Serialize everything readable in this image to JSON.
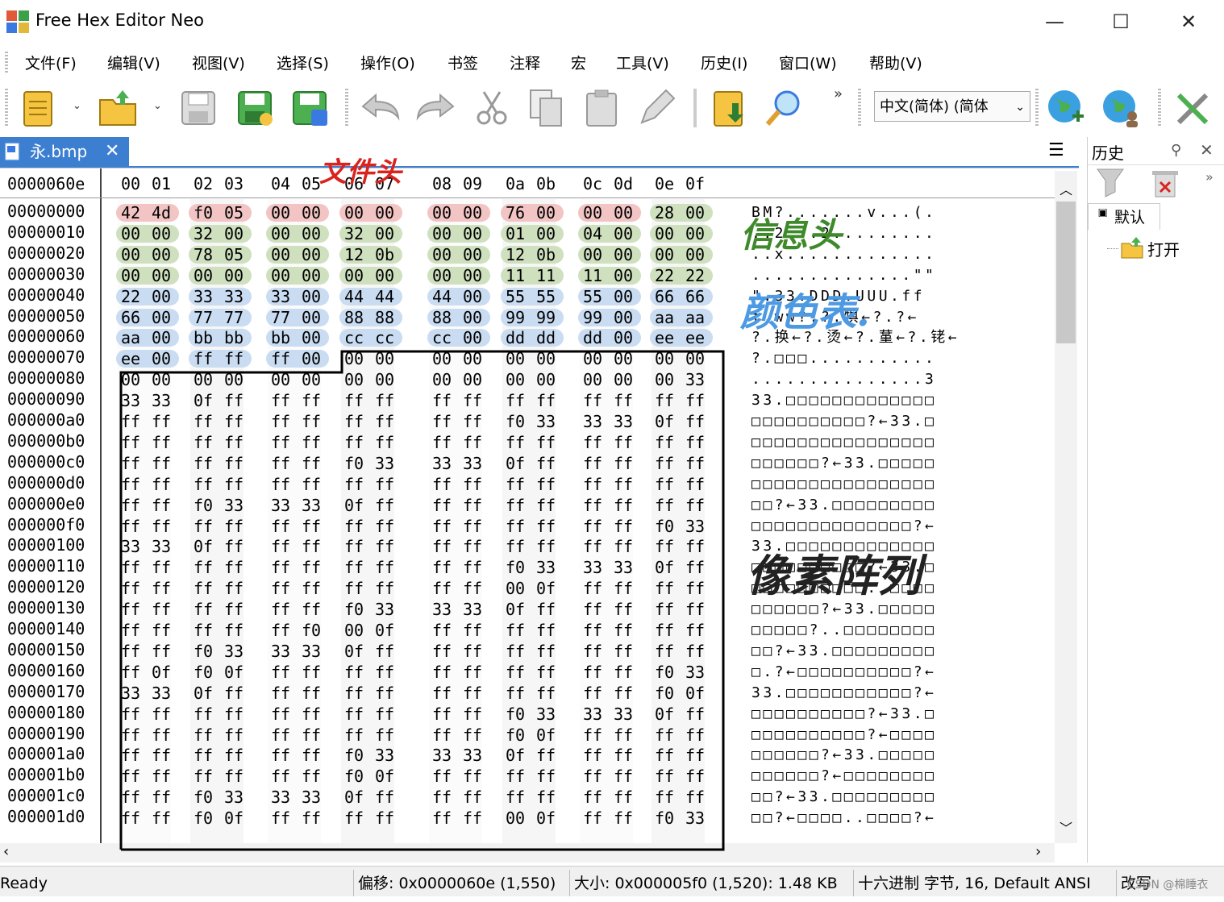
{
  "window": {
    "title": "Free Hex Editor Neo",
    "minimize": "—",
    "maximize": "☐",
    "close": "✕"
  },
  "menu": [
    "文件(F)",
    "编辑(V)",
    "视图(V)",
    "选择(S)",
    "操作(O)",
    "书签",
    "注释",
    "宏",
    "工具(V)",
    "历史(I)",
    "窗口(W)",
    "帮助(V)"
  ],
  "toolbar": {
    "language": "中文(简体) (简体",
    "overflow": "»"
  },
  "tab": {
    "name": "永.bmp",
    "close": "✕"
  },
  "hex": {
    "current_offset": "0000060e",
    "columns": [
      "00",
      "01",
      "02",
      "03",
      "04",
      "05",
      "06",
      "07",
      "08",
      "09",
      "0a",
      "0b",
      "0c",
      "0d",
      "0e",
      "0f"
    ],
    "rows": [
      {
        "offset": "00000000",
        "bytes": [
          "42",
          "4d",
          "f0",
          "05",
          "00",
          "00",
          "00",
          "00",
          "00",
          "00",
          "76",
          "00",
          "00",
          "00",
          "28",
          "00"
        ],
        "ascii": "BM?.......v...(."
      },
      {
        "offset": "00000010",
        "bytes": [
          "00",
          "00",
          "32",
          "00",
          "00",
          "00",
          "32",
          "00",
          "00",
          "00",
          "01",
          "00",
          "04",
          "00",
          "00",
          "00"
        ],
        "ascii": "..2...2........."
      },
      {
        "offset": "00000020",
        "bytes": [
          "00",
          "00",
          "78",
          "05",
          "00",
          "00",
          "12",
          "0b",
          "00",
          "00",
          "12",
          "0b",
          "00",
          "00",
          "00",
          "00"
        ],
        "ascii": "..x............."
      },
      {
        "offset": "00000030",
        "bytes": [
          "00",
          "00",
          "00",
          "00",
          "00",
          "00",
          "00",
          "00",
          "00",
          "00",
          "11",
          "11",
          "11",
          "00",
          "22",
          "22"
        ],
        "ascii": "..............\"\""
      },
      {
        "offset": "00000040",
        "bytes": [
          "22",
          "00",
          "33",
          "33",
          "33",
          "00",
          "44",
          "44",
          "44",
          "00",
          "55",
          "55",
          "55",
          "00",
          "66",
          "66"
        ],
        "ascii": "\".33.DDD.UUU.ff"
      },
      {
        "offset": "00000050",
        "bytes": [
          "66",
          "00",
          "77",
          "77",
          "77",
          "00",
          "88",
          "88",
          "88",
          "00",
          "99",
          "99",
          "99",
          "00",
          "aa",
          "aa"
        ],
        "ascii": "f.ww?.?.犋←?.?←"
      },
      {
        "offset": "00000060",
        "bytes": [
          "aa",
          "00",
          "bb",
          "bb",
          "bb",
          "00",
          "cc",
          "cc",
          "cc",
          "00",
          "dd",
          "dd",
          "dd",
          "00",
          "ee",
          "ee"
        ],
        "ascii": "?.换←?.烫←?.蓳←?.铑←"
      },
      {
        "offset": "00000070",
        "bytes": [
          "ee",
          "00",
          "ff",
          "ff",
          "ff",
          "00",
          "00",
          "00",
          "00",
          "00",
          "00",
          "00",
          "00",
          "00",
          "00",
          "00"
        ],
        "ascii": "?.□□□..........."
      },
      {
        "offset": "00000080",
        "bytes": [
          "00",
          "00",
          "00",
          "00",
          "00",
          "00",
          "00",
          "00",
          "00",
          "00",
          "00",
          "00",
          "00",
          "00",
          "00",
          "33"
        ],
        "ascii": "...............3"
      },
      {
        "offset": "00000090",
        "bytes": [
          "33",
          "33",
          "0f",
          "ff",
          "ff",
          "ff",
          "ff",
          "ff",
          "ff",
          "ff",
          "ff",
          "ff",
          "ff",
          "ff",
          "ff",
          "ff"
        ],
        "ascii": "33.□□□□□□□□□□□□□"
      },
      {
        "offset": "000000a0",
        "bytes": [
          "ff",
          "ff",
          "ff",
          "ff",
          "ff",
          "ff",
          "ff",
          "ff",
          "ff",
          "ff",
          "f0",
          "33",
          "33",
          "33",
          "0f",
          "ff"
        ],
        "ascii": "□□□□□□□□□□?←33.□"
      },
      {
        "offset": "000000b0",
        "bytes": [
          "ff",
          "ff",
          "ff",
          "ff",
          "ff",
          "ff",
          "ff",
          "ff",
          "ff",
          "ff",
          "ff",
          "ff",
          "ff",
          "ff",
          "ff",
          "ff"
        ],
        "ascii": "□□□□□□□□□□□□□□□□"
      },
      {
        "offset": "000000c0",
        "bytes": [
          "ff",
          "ff",
          "ff",
          "ff",
          "ff",
          "ff",
          "f0",
          "33",
          "33",
          "33",
          "0f",
          "ff",
          "ff",
          "ff",
          "ff",
          "ff"
        ],
        "ascii": "□□□□□□?←33.□□□□□"
      },
      {
        "offset": "000000d0",
        "bytes": [
          "ff",
          "ff",
          "ff",
          "ff",
          "ff",
          "ff",
          "ff",
          "ff",
          "ff",
          "ff",
          "ff",
          "ff",
          "ff",
          "ff",
          "ff",
          "ff"
        ],
        "ascii": "□□□□□□□□□□□□□□□□"
      },
      {
        "offset": "000000e0",
        "bytes": [
          "ff",
          "ff",
          "f0",
          "33",
          "33",
          "33",
          "0f",
          "ff",
          "ff",
          "ff",
          "ff",
          "ff",
          "ff",
          "ff",
          "ff",
          "ff"
        ],
        "ascii": "□□?←33.□□□□□□□□□"
      },
      {
        "offset": "000000f0",
        "bytes": [
          "ff",
          "ff",
          "ff",
          "ff",
          "ff",
          "ff",
          "ff",
          "ff",
          "ff",
          "ff",
          "ff",
          "ff",
          "ff",
          "ff",
          "f0",
          "33"
        ],
        "ascii": "□□□□□□□□□□□□□□?←"
      },
      {
        "offset": "00000100",
        "bytes": [
          "33",
          "33",
          "0f",
          "ff",
          "ff",
          "ff",
          "ff",
          "ff",
          "ff",
          "ff",
          "ff",
          "ff",
          "ff",
          "ff",
          "ff",
          "ff"
        ],
        "ascii": "33.□□□□□□□□□□□□□"
      },
      {
        "offset": "00000110",
        "bytes": [
          "ff",
          "ff",
          "ff",
          "ff",
          "ff",
          "ff",
          "ff",
          "ff",
          "ff",
          "ff",
          "f0",
          "33",
          "33",
          "33",
          "0f",
          "ff"
        ],
        "ascii": "□□□□□□□□□□?←33.□"
      },
      {
        "offset": "00000120",
        "bytes": [
          "ff",
          "ff",
          "ff",
          "ff",
          "ff",
          "ff",
          "ff",
          "ff",
          "ff",
          "ff",
          "00",
          "0f",
          "ff",
          "ff",
          "ff",
          "ff"
        ],
        "ascii": "□□□□□□□□□□..□□□□"
      },
      {
        "offset": "00000130",
        "bytes": [
          "ff",
          "ff",
          "ff",
          "ff",
          "ff",
          "ff",
          "f0",
          "33",
          "33",
          "33",
          "0f",
          "ff",
          "ff",
          "ff",
          "ff",
          "ff"
        ],
        "ascii": "□□□□□□?←33.□□□□□"
      },
      {
        "offset": "00000140",
        "bytes": [
          "ff",
          "ff",
          "ff",
          "ff",
          "ff",
          "f0",
          "00",
          "0f",
          "ff",
          "ff",
          "ff",
          "ff",
          "ff",
          "ff",
          "ff",
          "ff"
        ],
        "ascii": "□□□□□?..□□□□□□□□"
      },
      {
        "offset": "00000150",
        "bytes": [
          "ff",
          "ff",
          "f0",
          "33",
          "33",
          "33",
          "0f",
          "ff",
          "ff",
          "ff",
          "ff",
          "ff",
          "ff",
          "ff",
          "ff",
          "ff"
        ],
        "ascii": "□□?←33.□□□□□□□□□"
      },
      {
        "offset": "00000160",
        "bytes": [
          "ff",
          "0f",
          "f0",
          "0f",
          "ff",
          "ff",
          "ff",
          "ff",
          "ff",
          "ff",
          "ff",
          "ff",
          "ff",
          "ff",
          "f0",
          "33"
        ],
        "ascii": "□.?←□□□□□□□□□□?←"
      },
      {
        "offset": "00000170",
        "bytes": [
          "33",
          "33",
          "0f",
          "ff",
          "ff",
          "ff",
          "ff",
          "ff",
          "ff",
          "ff",
          "ff",
          "ff",
          "ff",
          "ff",
          "f0",
          "0f"
        ],
        "ascii": "33.□□□□□□□□□□□?←"
      },
      {
        "offset": "00000180",
        "bytes": [
          "ff",
          "ff",
          "ff",
          "ff",
          "ff",
          "ff",
          "ff",
          "ff",
          "ff",
          "ff",
          "f0",
          "33",
          "33",
          "33",
          "0f",
          "ff"
        ],
        "ascii": "□□□□□□□□□□?←33.□"
      },
      {
        "offset": "00000190",
        "bytes": [
          "ff",
          "ff",
          "ff",
          "ff",
          "ff",
          "ff",
          "ff",
          "ff",
          "ff",
          "ff",
          "f0",
          "0f",
          "ff",
          "ff",
          "ff",
          "ff"
        ],
        "ascii": "□□□□□□□□□□?←□□□□"
      },
      {
        "offset": "000001a0",
        "bytes": [
          "ff",
          "ff",
          "ff",
          "ff",
          "ff",
          "ff",
          "f0",
          "33",
          "33",
          "33",
          "0f",
          "ff",
          "ff",
          "ff",
          "ff",
          "ff"
        ],
        "ascii": "□□□□□□?←33.□□□□□"
      },
      {
        "offset": "000001b0",
        "bytes": [
          "ff",
          "ff",
          "ff",
          "ff",
          "ff",
          "ff",
          "f0",
          "0f",
          "ff",
          "ff",
          "ff",
          "ff",
          "ff",
          "ff",
          "ff",
          "ff"
        ],
        "ascii": "□□□□□□?←□□□□□□□□"
      },
      {
        "offset": "000001c0",
        "bytes": [
          "ff",
          "ff",
          "f0",
          "33",
          "33",
          "33",
          "0f",
          "ff",
          "ff",
          "ff",
          "ff",
          "ff",
          "ff",
          "ff",
          "ff",
          "ff"
        ],
        "ascii": "□□?←33.□□□□□□□□□"
      },
      {
        "offset": "000001d0",
        "bytes": [
          "ff",
          "ff",
          "f0",
          "0f",
          "ff",
          "ff",
          "ff",
          "ff",
          "ff",
          "ff",
          "00",
          "0f",
          "ff",
          "ff",
          "f0",
          "33"
        ],
        "ascii": "□□?←□□□□..□□□□?←"
      }
    ]
  },
  "annotations": {
    "file_header": "文件头",
    "info_header": "信息头",
    "palette": "颜色表.",
    "pixels": "像素阵列"
  },
  "side_panel": {
    "title": "历史",
    "group": "默认",
    "item": "打开"
  },
  "status": {
    "ready": "Ready",
    "offset": "偏移: 0x0000060e (1,550)",
    "size": "大小: 0x000005f0 (1,520): 1.48 KB",
    "mode": "十六进制 字节, 16, Default ANSI",
    "overwrite": "改写"
  },
  "watermark": "CSDN @棉睡衣",
  "colors": {
    "accent": "#3c7fd1",
    "red_hl": "#f2c4c4",
    "green_hl": "#cfe0bf",
    "blue_hl": "#c9dcf2",
    "col_hl": "#eeeeee"
  }
}
